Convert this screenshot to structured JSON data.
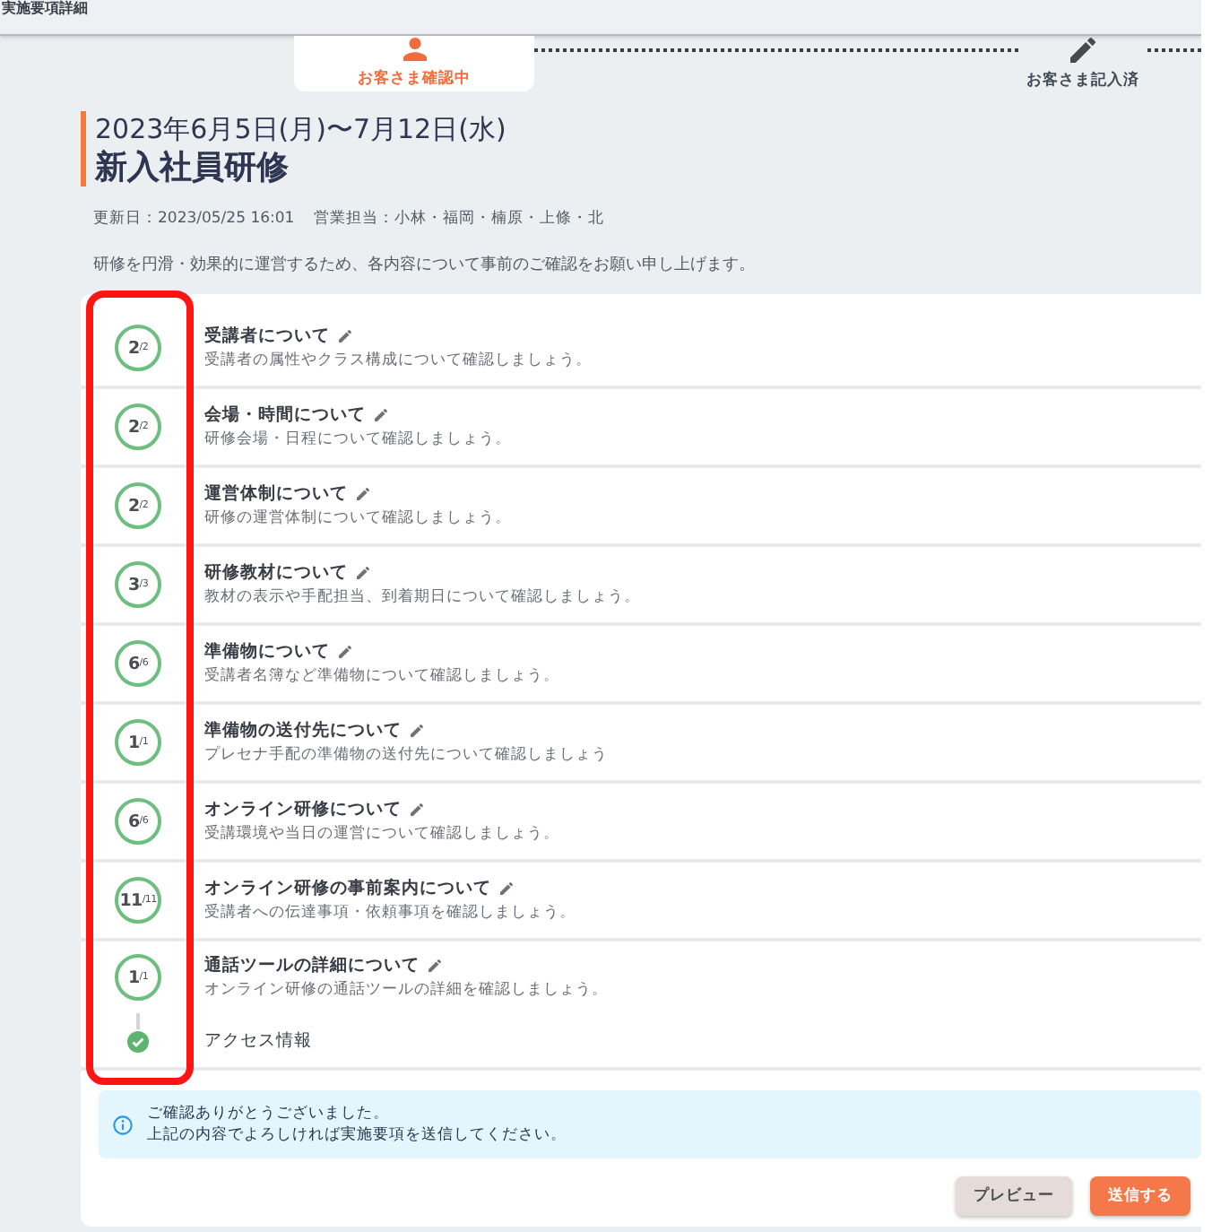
{
  "header": {
    "title": "実施要項詳細"
  },
  "stepper": [
    {
      "label": "お客さま確認中",
      "selected": true
    },
    {
      "label": "お客さま記入済",
      "selected": false
    }
  ],
  "schedule": {
    "dates": "2023年6月5日(月)〜7月12日(水)",
    "title": "新入社員研修"
  },
  "meta": {
    "updated": "更新日：2023/05/25 16:01",
    "sales": "営業担当：小林・福岡・楠原・上條・北"
  },
  "intro": "研修を円滑・効果的に運営するため、各内容について事前のご確認をお願い申し上げます。",
  "sections": [
    {
      "kind": "progress",
      "done": "2",
      "total": "/2",
      "title": "受講者について",
      "description": "受講者の属性やクラス構成について確認しましょう。"
    },
    {
      "kind": "progress",
      "done": "2",
      "total": "/2",
      "title": "会場・時間について",
      "description": "研修会場・日程について確認しましょう。"
    },
    {
      "kind": "progress",
      "done": "2",
      "total": "/2",
      "title": "運営体制について",
      "description": "研修の運営体制について確認しましょう。"
    },
    {
      "kind": "progress",
      "done": "3",
      "total": "/3",
      "title": "研修教材について",
      "description": "教材の表示や手配担当、到着期日について確認しましょう。"
    },
    {
      "kind": "progress",
      "done": "6",
      "total": "/6",
      "title": "準備物について",
      "description": "受講者名簿など準備物について確認しましょう。"
    },
    {
      "kind": "progress",
      "done": "1",
      "total": "/1",
      "title": "準備物の送付先について",
      "description": "プレセナ手配の準備物の送付先について確認しましょう"
    },
    {
      "kind": "progress",
      "done": "6",
      "total": "/6",
      "title": "オンライン研修について",
      "description": "受講環境や当日の運営について確認しましょう。"
    },
    {
      "kind": "progress",
      "done": "11",
      "total": "/11",
      "title": "オンライン研修の事前案内について",
      "description": "受講者への伝達事項・依頼事項を確認しましょう。"
    },
    {
      "kind": "progress",
      "done": "1",
      "total": "/1",
      "title": "通話ツールの詳細について",
      "description": "オンライン研修の通話ツールの詳細を確認しましょう。"
    },
    {
      "kind": "complete",
      "title": "アクセス情報"
    }
  ],
  "annotations": [
    {
      "kind": "frame"
    }
  ],
  "notice": {
    "lines": [
      "ご確認ありがとうございました。",
      "上記の内容でよろしければ実施要項を送信してください。"
    ]
  },
  "buttons": [
    {
      "label": "プレビュー",
      "kind": "secondary"
    },
    {
      "label": "送信する",
      "kind": "primary"
    }
  ]
}
